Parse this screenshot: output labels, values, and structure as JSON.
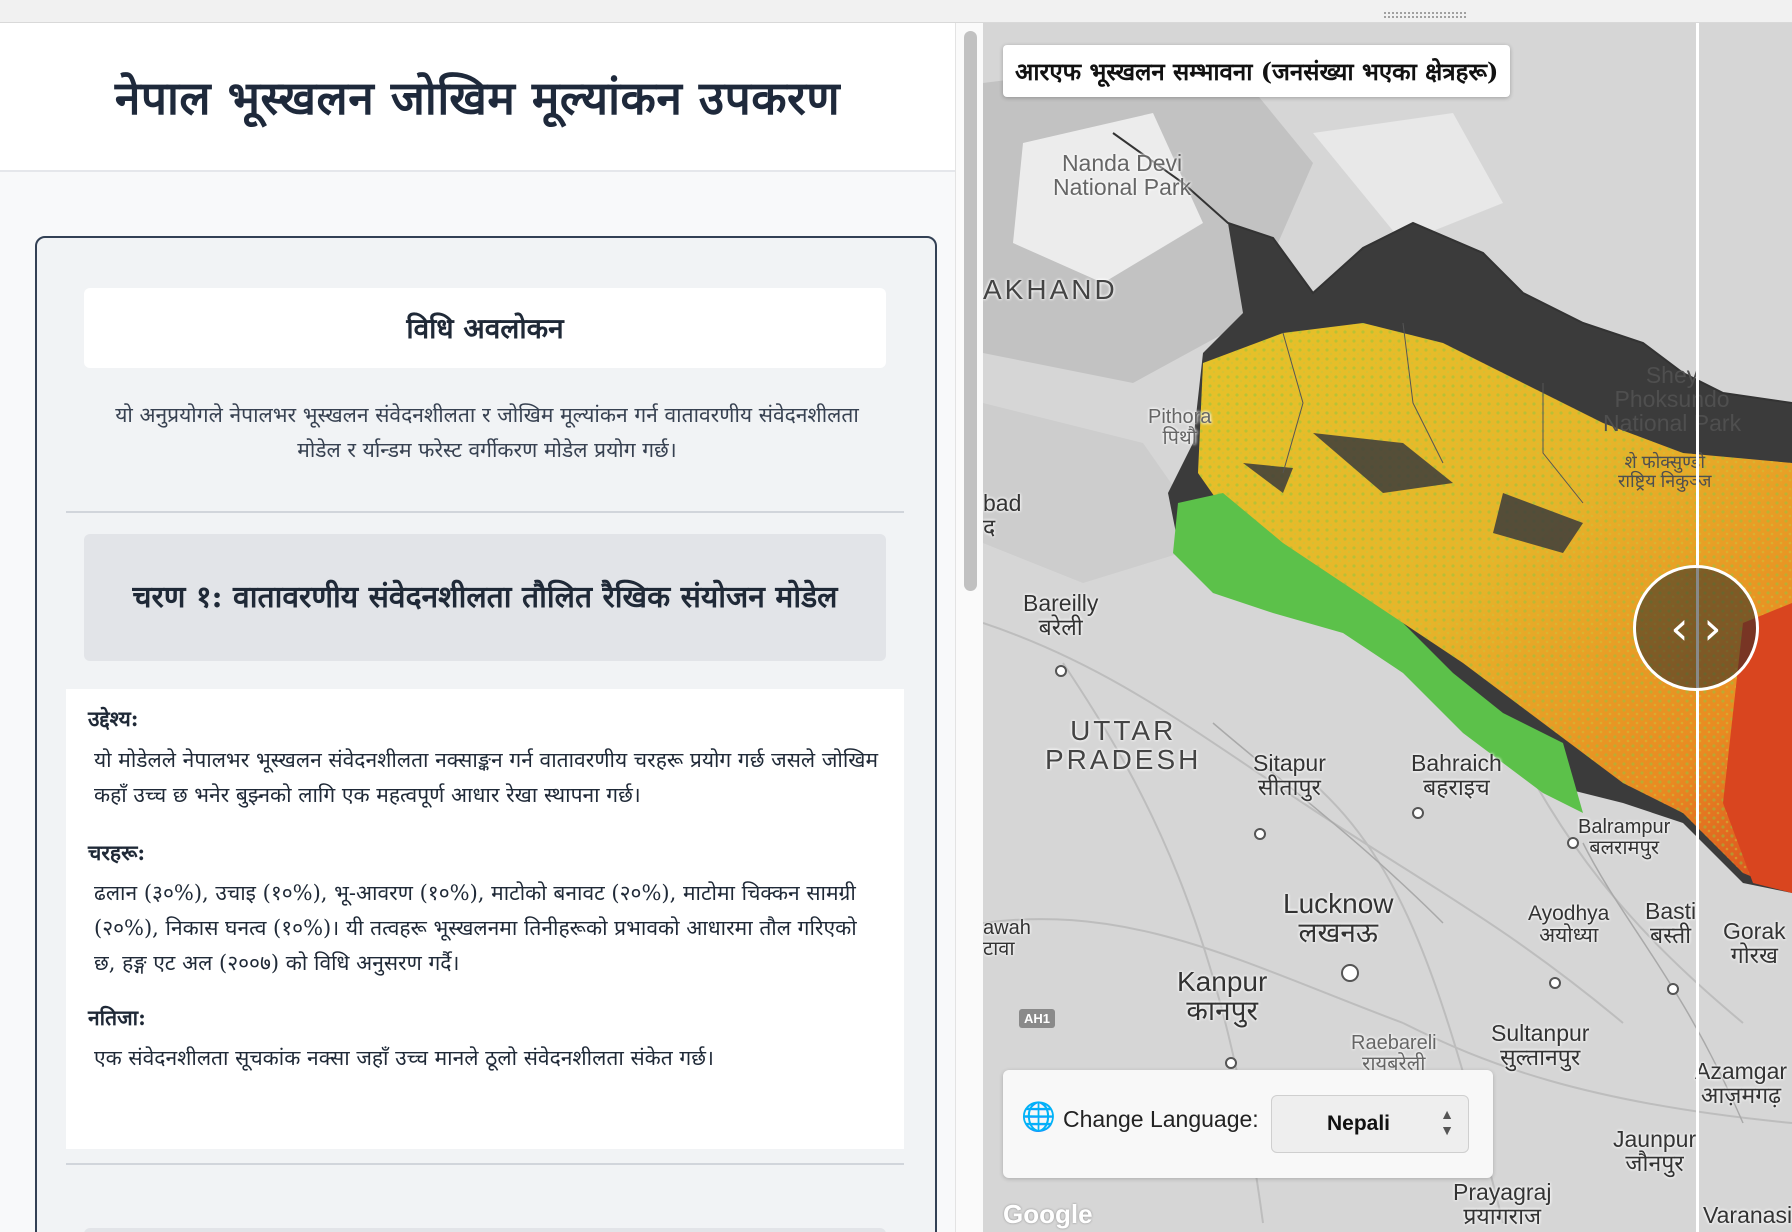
{
  "header": {
    "title": "नेपाल भूस्खलन जोखिम मूल्यांकन उपकरण"
  },
  "method": {
    "title": "विधि अवलोकन",
    "intro": "यो अनुप्रयोगले नेपालभर भूस्खलन संवेदनशीलता र जोखिम मूल्यांकन गर्न वातावरणीय संवेदनशीलता मोडेल र र्यान्डम फरेस्ट वर्गीकरण मोडेल प्रयोग गर्छ।",
    "step1": {
      "title": "चरण १: वातावरणीय संवेदनशीलता तौलित रैखिक संयोजन मोडेल",
      "objective_label": "उद्देश्य:",
      "objective_text": "यो मोडेलले नेपालभर भूस्खलन संवेदनशीलता नक्साङ्कन गर्न वातावरणीय चरहरू प्रयोग गर्छ जसले जोखिम कहाँ उच्च छ भनेर बुझ्नको लागि एक महत्वपूर्ण आधार रेखा स्थापना गर्छ।",
      "variables_label": "चरहरू:",
      "variables_text": "ढलान (३०%), उचाइ (१०%), भू-आवरण (१०%), माटोको बनावट (२०%), माटोमा चिक्कन सामग्री (२०%), निकास घनत्व (१०%)। यी तत्वहरू भूस्खलनमा तिनीहरूको प्रभावको आधारमा तौल गरिएको छ, हङ्ग एट अल (२००७) को विधि अनुसरण गर्दै।",
      "result_label": "नतिजा:",
      "result_text": "एक संवेदनशीलता सूचकांक नक्सा जहाँ उच्च मानले ठूलो संवेदनशीलता संकेत गर्छ।"
    }
  },
  "map": {
    "title": "आरएफ भूस्खलन सम्भावना (जनसंख्या भएका क्षेत्रहरू)",
    "labels": {
      "nanda_devi": "Nanda Devi\nNational Park",
      "akhand": "AKHAND",
      "pithora": "Pithora\nपिथौ",
      "shey": "Shey\nPhoksundo\nNational Park",
      "shey_dev": "शे फोक्सुण्डो\nराष्ट्रिय निकुञ्ज",
      "bad": "bad\nद",
      "bareilly": "Bareilly\nबरेली",
      "uttar_pradesh": "UTTAR\nPRADESH",
      "sitapur": "Sitapur\nसीतापुर",
      "bahraich": "Bahraich\nबहराइच",
      "balrampur": "Balrampur\nबलरामपुर",
      "lucknow": "Lucknow\nलखनऊ",
      "awah": "awah\nटावा",
      "ayodhya": "Ayodhya\nअयोध्या",
      "basti": "Basti\nबस्ती",
      "gorak": "Gorak\nगोरख",
      "kanpur": "Kanpur\nकानपुर",
      "raebareli": "Raebareli\nरायबरेली",
      "sultanpur": "Sultanpur\nसुल्तानपुर",
      "azamgarh": "Azamgar\nआज़मगढ़",
      "jaunpur": "Jaunpur\nजौनपुर",
      "prayagraj": "Prayagraj\nप्रयागराज",
      "varanasi": "Varanasi",
      "ah1": "AH1",
      "google": "Google"
    },
    "language": {
      "label": "Change Language:",
      "selected": "Nepali",
      "icon": "globe-icon"
    },
    "slider_icon": "chevron-left-right-icon",
    "colors": {
      "nepal_base": "#3b3b3b",
      "low": "#5cc14a",
      "medium": "#e6c229",
      "high": "#e98a22",
      "very_high": "#d9451f"
    }
  }
}
